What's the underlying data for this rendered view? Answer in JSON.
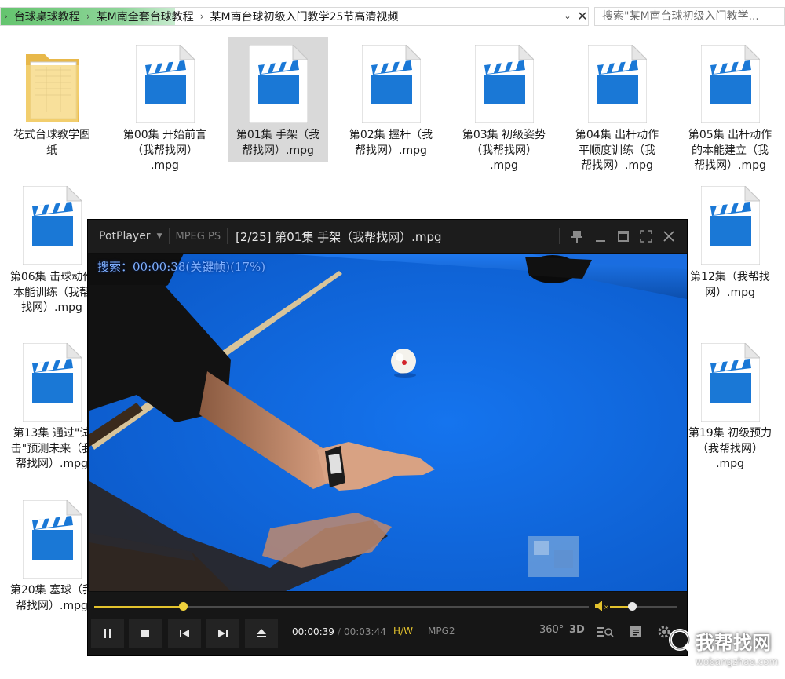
{
  "address_bar": {
    "crumbs": [
      "台球桌球教程",
      "某M南全套台球教程",
      "某M南台球初级入门教学25节高清视频"
    ],
    "separator": "›",
    "search_placeholder": "搜索\"某M南台球初级入门教学..."
  },
  "files": [
    {
      "name": "花式台球教学图\n纸",
      "icon": "folder-icon"
    },
    {
      "name": "第00集 开始前言\n（我帮找网）\n.mpg",
      "icon": "video-file-icon"
    },
    {
      "name": "第01集 手架（我\n帮找网）.mpg",
      "icon": "video-file-icon",
      "selected": true
    },
    {
      "name": "第02集 握杆（我\n帮找网）.mpg",
      "icon": "video-file-icon"
    },
    {
      "name": "第03集 初级姿势\n（我帮找网）\n.mpg",
      "icon": "video-file-icon"
    },
    {
      "name": "第04集 出杆动作\n平顺度训练（我\n帮找网）.mpg",
      "icon": "video-file-icon"
    },
    {
      "name": "第05集 出杆动作\n的本能建立（我\n帮找网）.mpg",
      "icon": "video-file-icon"
    },
    {
      "name": "第06集 击球动作\n本能训练（我帮\n找网）.mpg",
      "icon": "video-file-icon"
    },
    {
      "name": "第12集（我帮找\n网）.mpg",
      "icon": "video-file-icon"
    },
    {
      "name": "第13集 通过\"试\n击\"预测未来（我\n帮找网）.mpg",
      "icon": "video-file-icon"
    },
    {
      "name": "第19集 初级预力\n（我帮找网）\n.mpg",
      "icon": "video-file-icon"
    },
    {
      "name": "第20集 塞球（我\n帮找网）.mpg",
      "icon": "video-file-icon"
    }
  ],
  "player": {
    "brand": "PotPlayer",
    "codec": "MPEG PS",
    "title": "[2/25] 第01集 手架（我帮找网）.mpg",
    "osd": "搜索：00:00:38(关键帧)(17%)",
    "seek_progress": 0.18,
    "volume_level": 0.33,
    "time_current": "00:00:39",
    "time_sep": "/",
    "time_total": "00:03:44",
    "hw_label": "H/W",
    "format_label": "MPG2",
    "icon_360": "360°",
    "icon_3d": "3D"
  },
  "watermark": {
    "text": "我帮找网",
    "url": "wobangzhao.com"
  },
  "colors": {
    "accent_yellow": "#e3c22d",
    "felt_blue": "#0e63d8",
    "video_icon_blue": "#1a78d6",
    "selection_gray": "#d9d9d9"
  }
}
